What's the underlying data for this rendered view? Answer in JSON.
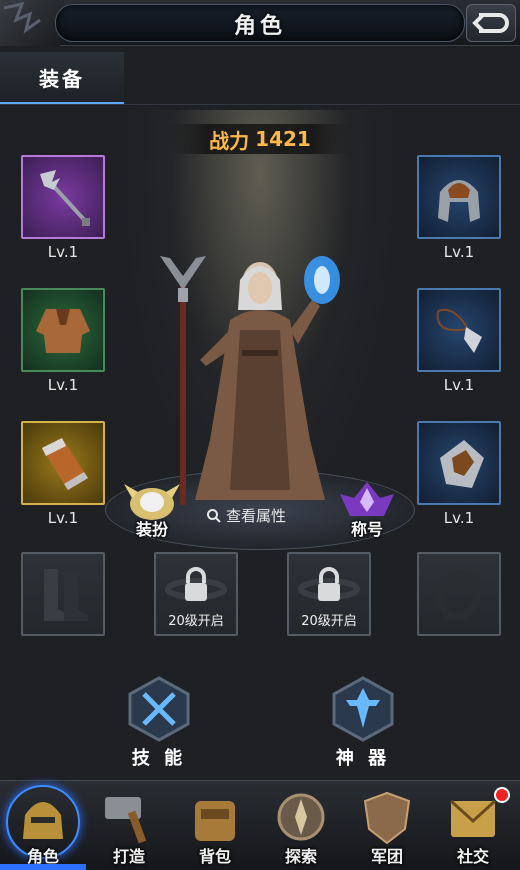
{
  "header": {
    "title": "角色"
  },
  "tab": {
    "label": "装备"
  },
  "power": {
    "label": "战力",
    "value": "1421"
  },
  "left_slots": [
    {
      "name": "staff",
      "lv": "Lv.1",
      "quality": "purple"
    },
    {
      "name": "robe",
      "lv": "Lv.1",
      "quality": "green"
    },
    {
      "name": "bracer",
      "lv": "Lv.1",
      "quality": "gold"
    }
  ],
  "right_slots": [
    {
      "name": "helmet",
      "lv": "Lv.1",
      "quality": "blue"
    },
    {
      "name": "necklace",
      "lv": "Lv.1",
      "quality": "blue"
    },
    {
      "name": "gauntlet",
      "lv": "Lv.1",
      "quality": "blue"
    }
  ],
  "bottom_slots": [
    {
      "name": "boots",
      "locked": false
    },
    {
      "name": "ring-locked-1",
      "locked": true,
      "text": "20级开启"
    },
    {
      "name": "ring-locked-2",
      "locked": true,
      "text": "20级开启"
    },
    {
      "name": "ring",
      "locked": false
    }
  ],
  "pedestal": {
    "dress_label": "装扮",
    "view_attr_label": "查看属性",
    "title_label": "称号"
  },
  "actions": {
    "skill_label": "技 能",
    "artifact_label": "神 器"
  },
  "nav": [
    {
      "label": "角色",
      "active": true
    },
    {
      "label": "打造"
    },
    {
      "label": "背包"
    },
    {
      "label": "探索"
    },
    {
      "label": "军团"
    },
    {
      "label": "社交",
      "badge": true
    }
  ],
  "colors": {
    "accent": "#2d6fff",
    "power": "#ffb84a"
  }
}
